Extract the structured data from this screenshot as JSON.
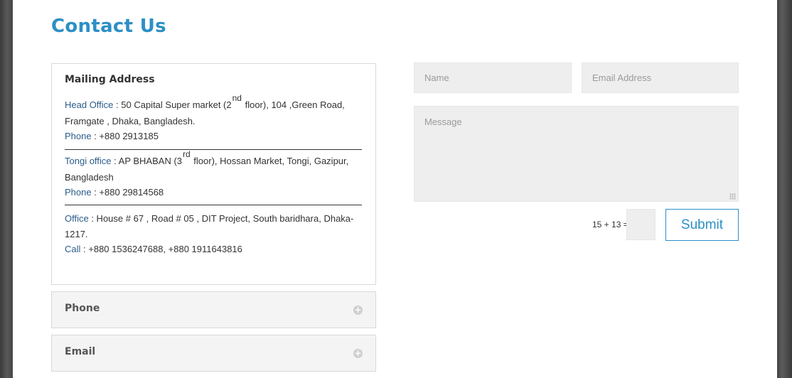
{
  "page_title": "Contact Us",
  "mailing": {
    "heading": "Mailing Address",
    "head_office": {
      "label": "Head Office",
      "text_a": " : 50 Capital Super market (2",
      "sup": "nd",
      "text_b": " floor), 104 ,Green Road, Framgate , Dhaka, Bangladesh.",
      "phone_label": "Phone",
      "phone_value": " :  +880 2913185"
    },
    "tongi_office": {
      "label": "Tongi office",
      "text_a": " : AP BHABAN (3",
      "sup": "rd",
      "text_b": " floor), Hossan Market, Tongi, Gazipur, Bangladesh",
      "phone_label": "Phone",
      "phone_value": " : +880 29814568"
    },
    "office": {
      "label": "Office",
      "text": " : House # 67 , Road # 05 , DIT Project, South baridhara, Dhaka-1217.",
      "call_label": "Call",
      "call_value": " : +880 1536247688, +880 1911643816"
    }
  },
  "accordion": [
    {
      "title": "Phone",
      "icon": "plus-circle-icon",
      "icon_glyph": "+"
    },
    {
      "title": "Email",
      "icon": "plus-circle-icon",
      "icon_glyph": "+"
    }
  ],
  "form": {
    "name_placeholder": "Name",
    "email_placeholder": "Email Address",
    "message_placeholder": "Message",
    "captcha_label": "15 + 13 =",
    "captcha_value": "",
    "submit_label": "Submit"
  },
  "colors": {
    "accent": "#2c8fc6",
    "link_label": "#2b5c8a",
    "field_bg": "#eeeeee",
    "accordion_bg": "#f4f4f4"
  }
}
